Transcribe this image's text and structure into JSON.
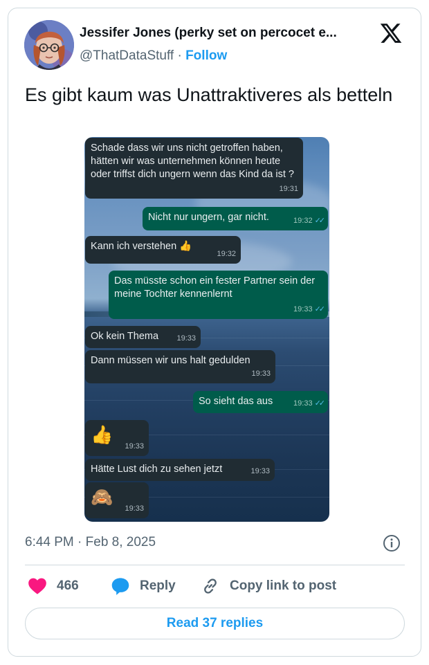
{
  "author": {
    "name": "Jessifer Jones (perky set on percocet e...",
    "handle": "@ThatDataStuff",
    "separator": "·",
    "follow_label": "Follow"
  },
  "tweet": {
    "text": "Es gibt kaum was Unattraktiveres als betteln",
    "timestamp": "6:44 PM · Feb 8, 2025"
  },
  "chat": {
    "messages": [
      {
        "dir": "in",
        "text": "Schade dass wir uns nicht getroffen haben, hätten wir was unternehmen können heute oder triffst dich ungern wenn das Kind da ist ?",
        "time": "19:31"
      },
      {
        "dir": "out",
        "text": "Nicht nur ungern, gar nicht.",
        "time": "19:32"
      },
      {
        "dir": "in",
        "text": "Kann ich verstehen 👍",
        "time": "19:32"
      },
      {
        "dir": "out",
        "text": "Das müsste schon ein fester Partner sein der meine Tochter kennenlernt",
        "time": "19:33"
      },
      {
        "dir": "in",
        "text": "Ok kein Thema",
        "time": "19:33"
      },
      {
        "dir": "in",
        "text": "Dann müssen wir uns halt gedulden",
        "time": "19:33"
      },
      {
        "dir": "out",
        "text": "So sieht das aus",
        "time": "19:33"
      },
      {
        "dir": "in",
        "text": "👍",
        "time": "19:33"
      },
      {
        "dir": "in",
        "text": "Hätte Lust dich zu sehen jetzt",
        "time": "19:33"
      },
      {
        "dir": "in",
        "text": "🙈",
        "time": "19:33"
      }
    ]
  },
  "actions": {
    "likes_count": "466",
    "reply_label": "Reply",
    "copy_label": "Copy link to post"
  },
  "read_replies_label": "Read 37 replies",
  "colors": {
    "accent": "#1d9bf0",
    "heart": "#f91880",
    "incoming_bubble": "#202c33",
    "outgoing_bubble": "#005c4b",
    "read_ticks": "#53bdeb"
  },
  "icons": [
    "x-logo-icon",
    "info-icon",
    "heart-icon",
    "reply-bubble-icon",
    "link-icon",
    "double-check-icon"
  ]
}
